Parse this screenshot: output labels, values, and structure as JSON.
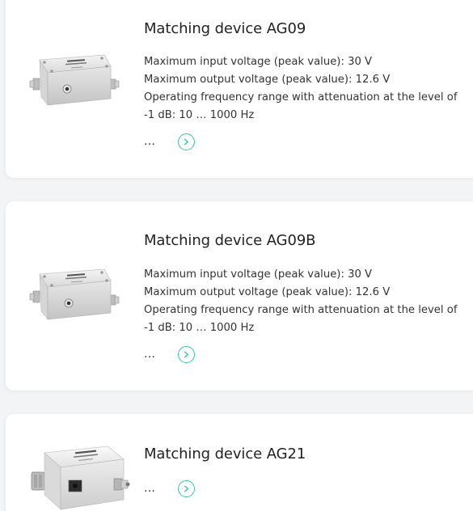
{
  "products": [
    {
      "title": "Matching device AG09",
      "specs": [
        "Maximum input voltage (peak value): 30 V",
        "Maximum output voltage (peak value): 12.6 V",
        "Operating frequency range with attenuation at the level of",
        "-1 dB: 10 … 1000 Hz"
      ],
      "more_text": "…",
      "icon": "chevron-right-circle-icon"
    },
    {
      "title": "Matching device AG09B",
      "specs": [
        "Maximum input voltage (peak value): 30 V",
        "Maximum output voltage (peak value): 12.6 V",
        "Operating frequency range with attenuation at the level of",
        "-1 dB: 10 … 1000 Hz"
      ],
      "more_text": "…",
      "icon": "chevron-right-circle-icon"
    },
    {
      "title": "Matching device AG21",
      "more_text": "…",
      "icon": "chevron-right-circle-icon"
    }
  ],
  "colors": {
    "accent": "#3cc2a8",
    "card_background": "#ffffff",
    "page_background": "#f3f4f6"
  }
}
